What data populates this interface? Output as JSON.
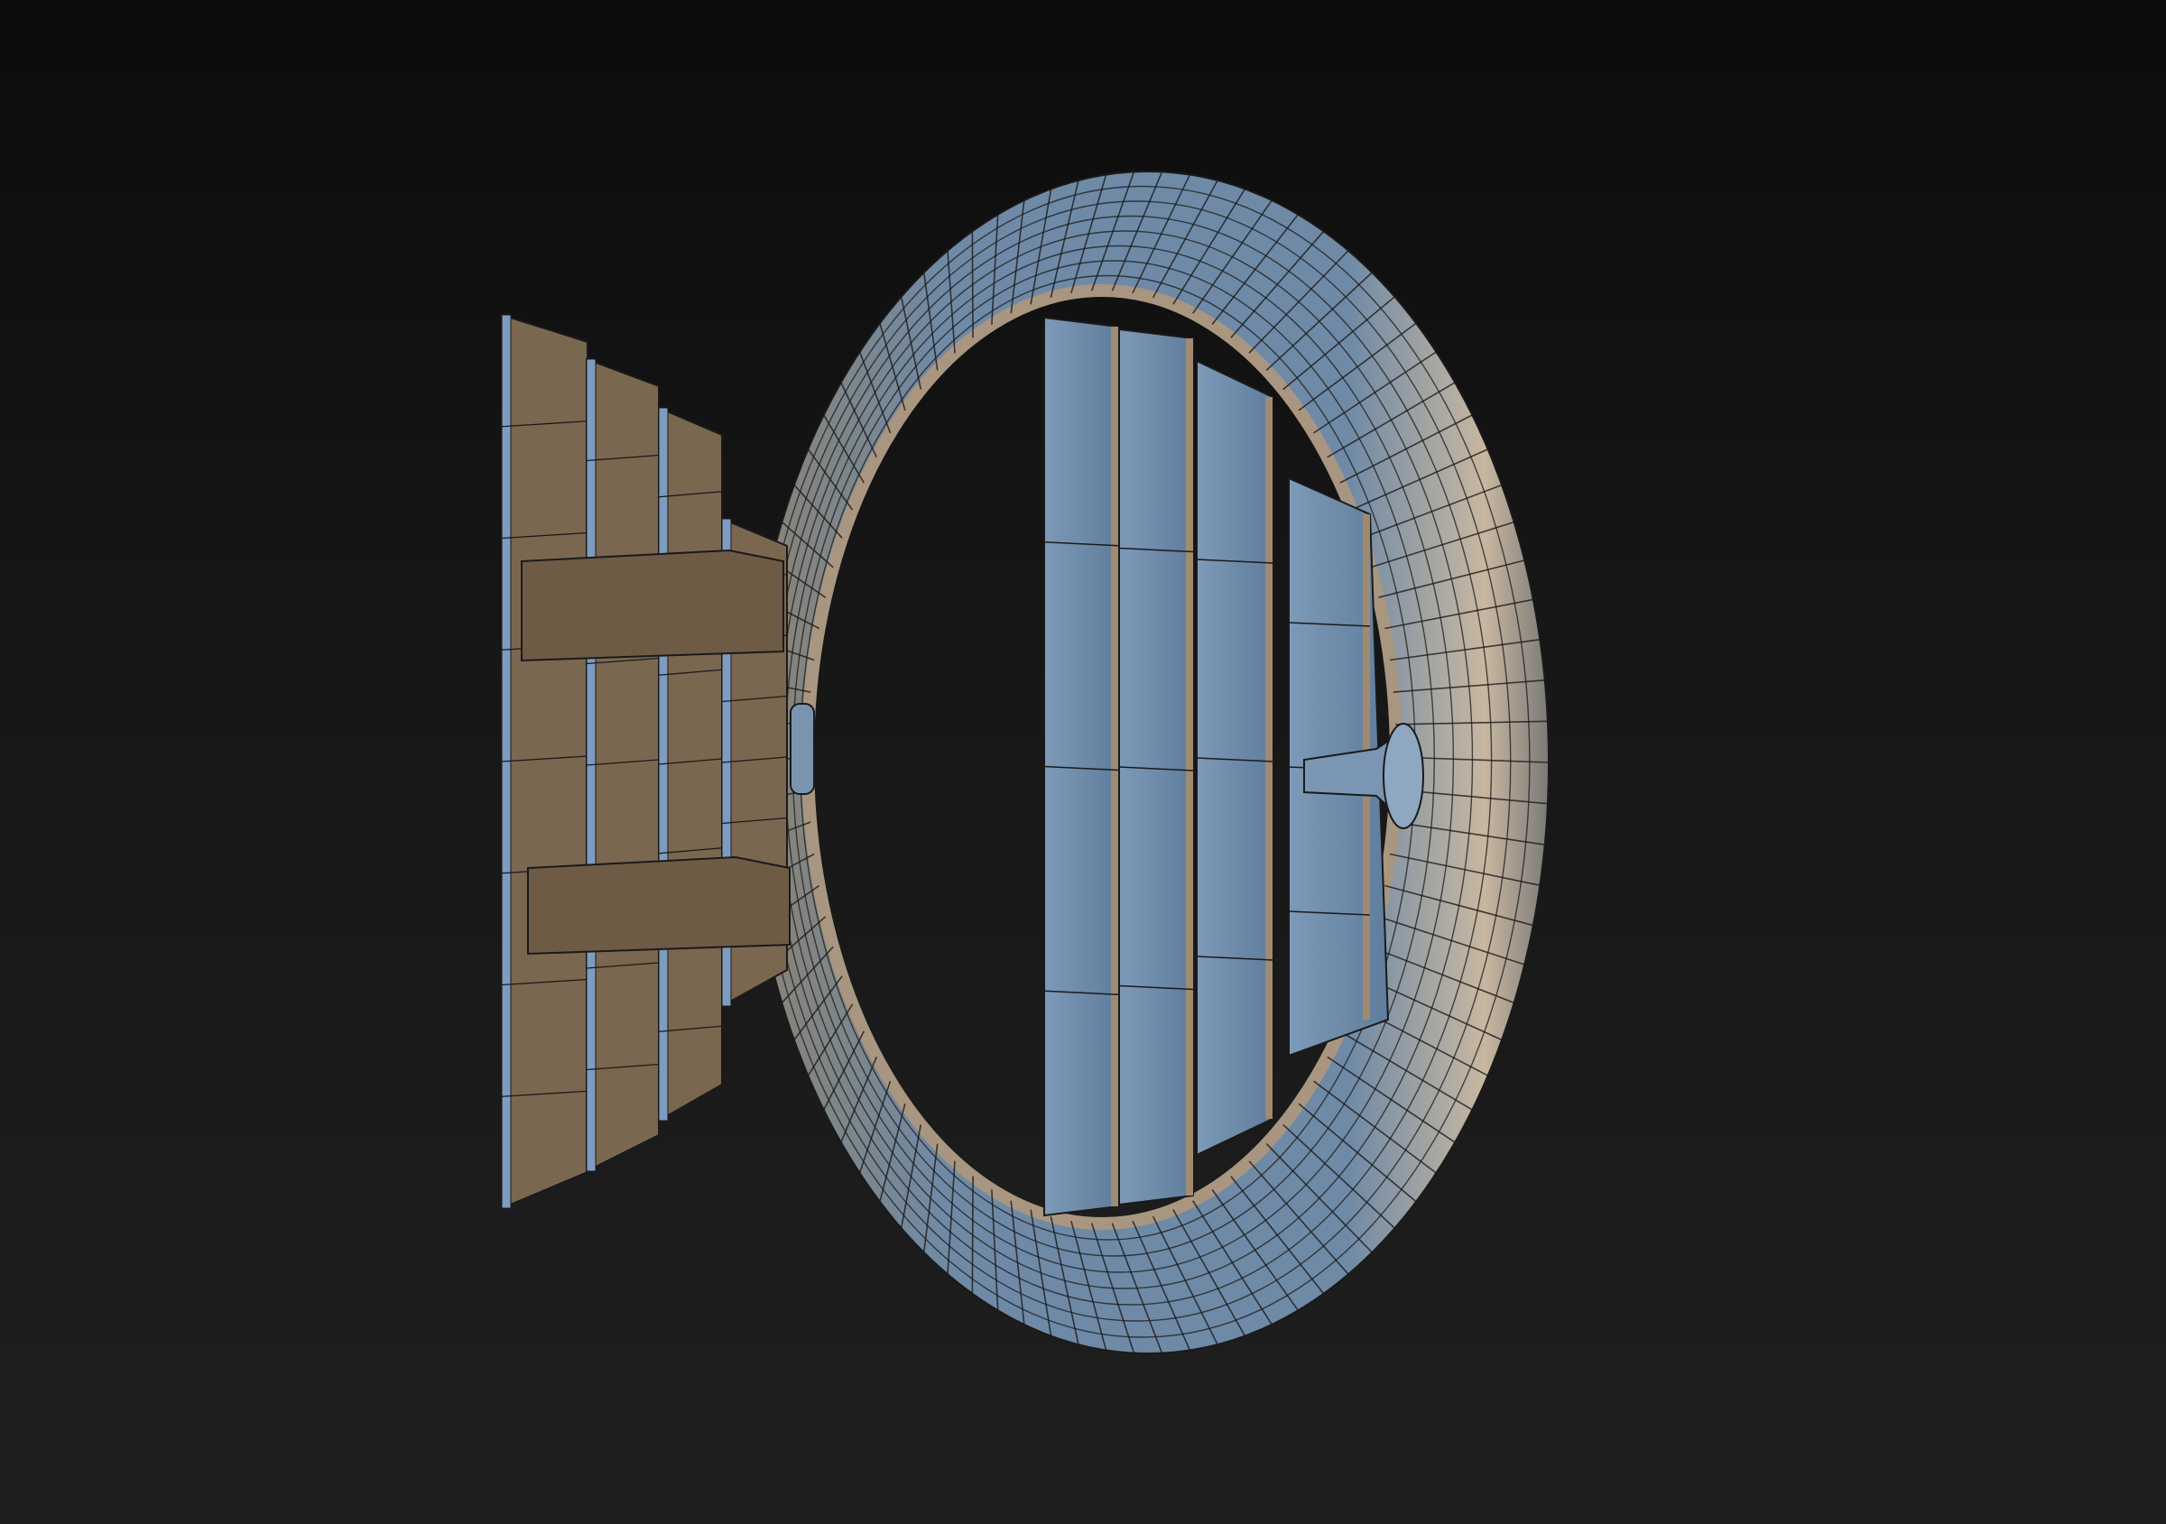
{
  "viewport": {
    "background_top": "#0c0c0c",
    "background_bottom": "#1f1f1f"
  },
  "model": {
    "ring_color": "#6f8aa6",
    "ring_highlight": "#b9a58e",
    "ring_shadow": "#3f5670",
    "wire_color": "#1a1a1a",
    "door_plank_color": "#7a6750",
    "door_edge_color": "#7d9cbf",
    "inner_panel_color": "#7190b0",
    "inner_panel_edge": "#a08a70"
  }
}
